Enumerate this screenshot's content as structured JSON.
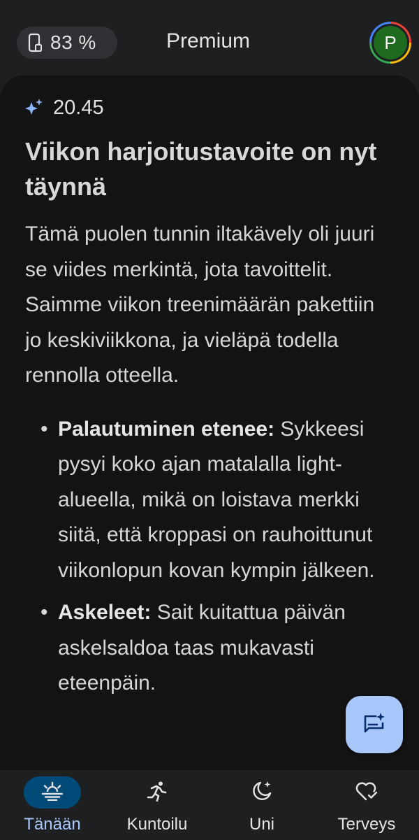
{
  "header": {
    "battery_percent": "83 %",
    "title": "Premium",
    "avatar_letter": "P"
  },
  "card": {
    "time": "20.45",
    "headline": "Viikon harjoitustavoite on nyt täynnä",
    "body": "Tämä puolen tunnin iltakävely oli juuri se viides merkintä, jota tavoittelit. Saimme viikon treenimäärän pakettiin jo keskiviikkona, ja vieläpä todella rennolla otteella.",
    "bullets": [
      {
        "title": "Palautuminen etenee:",
        "text": " Sykkeesi pysyi koko ajan matalalla light-alueella, mikä on loistava merkki siitä, että kroppasi on rauhoittunut viikonlopun kovan kympin jälkeen."
      },
      {
        "title": "Askeleet:",
        "text": " Sait kuitattua päivän askelsaldoa taas mukavasti eteenpäin."
      }
    ]
  },
  "bottom_nav": {
    "items": [
      {
        "label": "Tänään",
        "icon": "sunrise-icon",
        "active": true
      },
      {
        "label": "Kuntoilu",
        "icon": "running-icon",
        "active": false
      },
      {
        "label": "Uni",
        "icon": "moon-icon",
        "active": false
      },
      {
        "label": "Terveys",
        "icon": "heart-check-icon",
        "active": false
      }
    ]
  },
  "colors": {
    "background": "#1e1f21",
    "card": "#131314",
    "accent": "#a8c7fa",
    "nav_active_bg": "#004a77",
    "avatar_bg": "#1e6b20"
  }
}
